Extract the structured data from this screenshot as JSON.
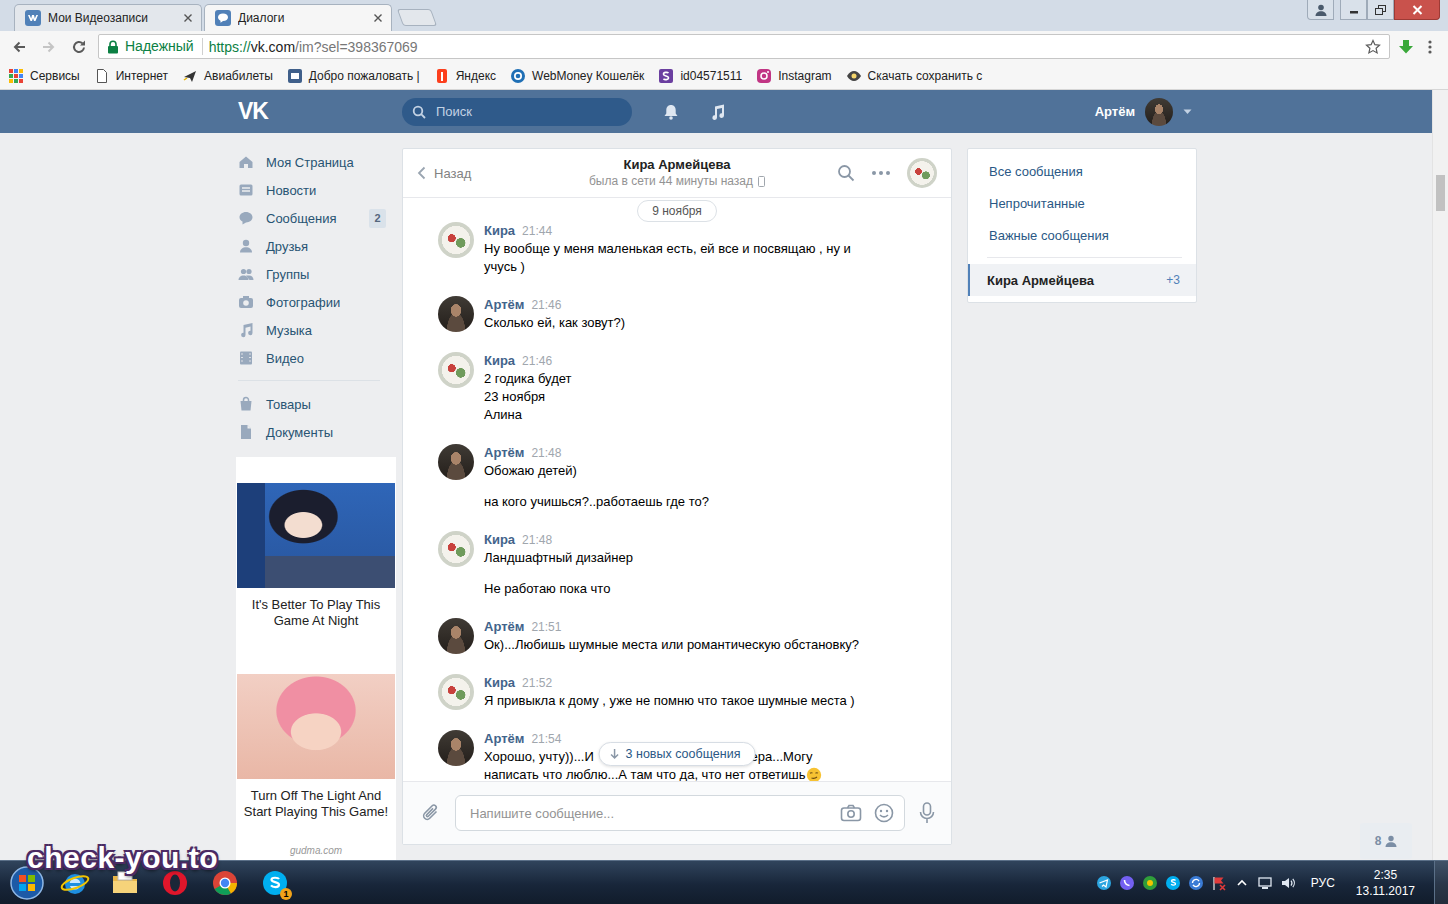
{
  "browser": {
    "tabs": [
      {
        "label": "Мои Видеозаписи",
        "selected": false
      },
      {
        "label": "Диалоги",
        "selected": true
      }
    ],
    "security": "Надежный",
    "url": {
      "scheme": "https://",
      "host": "vk.com",
      "path": "/im?sel=398367069"
    },
    "bookmarks": [
      "Сервисы",
      "Интернет",
      "Авиабилеты",
      "Добро пожаловать |",
      "Яндекс",
      "WebMoney Кошелёк",
      "id04571511",
      "Instagram",
      "Скачать сохранить с"
    ]
  },
  "header": {
    "logo": "VK",
    "search_placeholder": "Поиск",
    "user": "Артём"
  },
  "sidebar": {
    "main": [
      {
        "label": "Моя Страница"
      },
      {
        "label": "Новости"
      },
      {
        "label": "Сообщения",
        "badge": "2"
      },
      {
        "label": "Друзья"
      },
      {
        "label": "Группы"
      },
      {
        "label": "Фотографии"
      },
      {
        "label": "Музыка"
      },
      {
        "label": "Видео"
      }
    ],
    "extra": [
      {
        "label": "Товары"
      },
      {
        "label": "Документы"
      }
    ]
  },
  "ads": {
    "items": [
      {
        "caption": "It's Better To Play This Game At Night"
      },
      {
        "caption": "Turn Off The Light And Start Playing This Game!"
      }
    ],
    "source": "gudma.com"
  },
  "chat": {
    "back": "Назад",
    "name": "Кира Армейцева",
    "status": "была в сети 44 минуты назад",
    "date": "9 ноября",
    "messages": [
      {
        "author": "Кира",
        "time": "21:44",
        "kind": "incoming",
        "paragraphs": [
          {
            "lines": [
              "Ну вообще у меня маленькая есть, ей все и посвящаю , ну и",
              "учусь )"
            ]
          }
        ]
      },
      {
        "author": "Артём",
        "time": "21:46",
        "kind": "outgoing",
        "paragraphs": [
          {
            "lines": [
              "Сколько ей, как зовут?)"
            ]
          }
        ]
      },
      {
        "author": "Кира",
        "time": "21:46",
        "kind": "incoming",
        "paragraphs": [
          {
            "lines": [
              "2 годика будет",
              "23 ноября",
              "Алина"
            ]
          }
        ]
      },
      {
        "author": "Артём",
        "time": "21:48",
        "kind": "outgoing",
        "paragraphs": [
          {
            "lines": [
              "Обожаю детей)"
            ]
          },
          {
            "lines": [
              "на кого учишься?..работаешь где то?"
            ]
          }
        ]
      },
      {
        "author": "Кира",
        "time": "21:48",
        "kind": "incoming",
        "paragraphs": [
          {
            "lines": [
              "Ландшафтный дизайнер"
            ]
          },
          {
            "lines": [
              "Не работаю пока что"
            ]
          }
        ]
      },
      {
        "author": "Артём",
        "time": "21:51",
        "kind": "outgoing",
        "paragraphs": [
          {
            "lines": [
              "Ок)...Любишь шумные места или романтическую обстановку?"
            ]
          }
        ]
      },
      {
        "author": "Кира",
        "time": "21:52",
        "kind": "incoming",
        "paragraphs": [
          {
            "lines": [
              "Я привыкла к дому , уже не помню что такое шумные места )"
            ]
          }
        ]
      },
      {
        "author": "Артём",
        "time": "21:54",
        "kind": "outgoing",
        "paragraphs": [
          {
            "lines": [
              {
                "fragments": [
                  "Хорошо, учту))...И",
                  "чера...Могу"
                ]
              },
              {
                "text": "написать что люблю...А там что да, что нет ответишь",
                "emoji": true
              }
            ]
          }
        ]
      }
    ],
    "new_messages": "3 новых сообщения",
    "input_placeholder": "Напишите сообщение..."
  },
  "dialogs": {
    "filters": [
      {
        "label": "Все сообщения",
        "selected": false
      },
      {
        "label": "Непрочитанные",
        "selected": false
      },
      {
        "label": "Важные сообщения",
        "selected": false
      }
    ],
    "conversations": [
      {
        "name": "Кира Армейцева",
        "unread": "+3",
        "selected": true
      }
    ]
  },
  "online": {
    "count": "8"
  },
  "scrollbar": {
    "level": 0.11
  },
  "taskbar": {
    "skype_badge": "1",
    "language": "РУС",
    "time": "2:35",
    "date": "13.11.2017"
  },
  "watermark": "check-you.to"
}
